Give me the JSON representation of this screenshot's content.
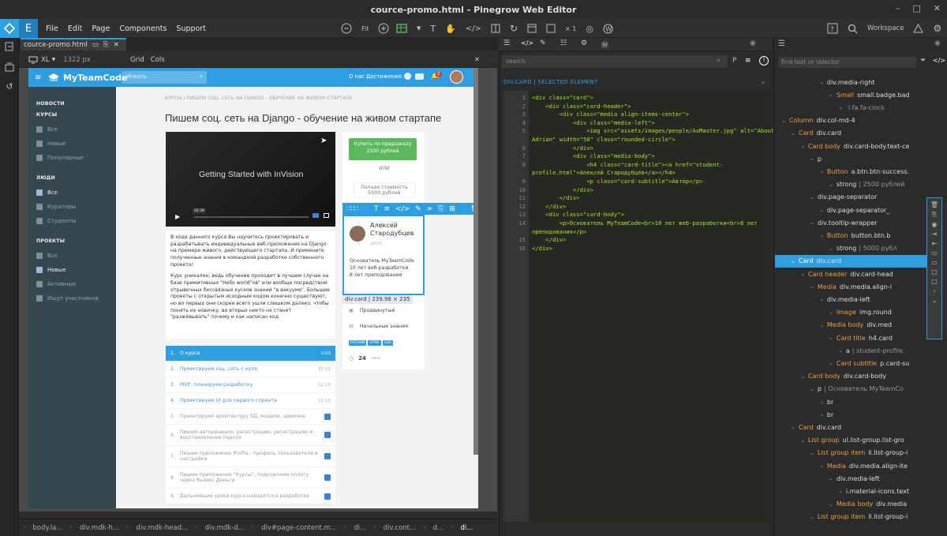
{
  "app": {
    "title": "cource-promo.html - Pinegrow Web Editor"
  },
  "menu": [
    "File",
    "Edit",
    "Page",
    "Components",
    "Support"
  ],
  "toolbar": {
    "fit_label": "Fit",
    "multiplier": "× 1",
    "workspace": "Workspace"
  },
  "tab": {
    "label": "cource-promo.html"
  },
  "device": {
    "size": "XL",
    "width": "1322 px",
    "grid": "Grid",
    "cols": "Cols"
  },
  "site": {
    "brand": "MyTeamCode",
    "search_placeholder": "Искать",
    "nav_links": "О нас  Достижения",
    "notif_count": "2",
    "sidebar": [
      {
        "type": "heading",
        "label": "НОВОСТИ"
      },
      {
        "type": "heading",
        "label": "КУРСЫ"
      },
      {
        "type": "item",
        "label": "Все"
      },
      {
        "type": "item",
        "label": "Новые"
      },
      {
        "type": "item",
        "label": "Популярные"
      },
      {
        "type": "heading",
        "label": "ЛЮДИ"
      },
      {
        "type": "item",
        "label": "Все",
        "active": true
      },
      {
        "type": "item",
        "label": "Кураторы"
      },
      {
        "type": "item",
        "label": "Студенты"
      },
      {
        "type": "heading",
        "label": "ПРОЕКТЫ"
      },
      {
        "type": "item",
        "label": "Все"
      },
      {
        "type": "item",
        "label": "Новые",
        "active": true
      },
      {
        "type": "item",
        "label": "Активные"
      },
      {
        "type": "item",
        "label": "Ищут участников"
      }
    ],
    "breadcrumb": "КУРСЫ  /  ПИШЕМ СОЦ. СЕТЬ НА DJANGO - ОБУЧЕНИЕ НА ЖИВОМ СТАРТАПЕ",
    "heading": "Пишем соц. сеть на Django - обучение на живом стартапе",
    "video": {
      "title": "Getting Started with InVision",
      "time": "02:36"
    },
    "description_p1": "В ходе данного курса Вы научитесь проектировать и разрабатывать индивидуальные веб-приложения на Django на примере живого, действующего стартапа. И примените полученные знания в командной разработке собственного проекта!",
    "description_p2": "Курс уникален, ведь обучение проходит в лучшем случае на базе примитивных \"Hello world\"ов\" или вообще посредством отрывочных бессвязных кусков знаний \"в вакууме\". Большие проекты с открытым исходным кодом конечно существуют, но во первых они скорее всего ушли слишком далеко, чтобы понять их новичку, во вторых никто не станет \"разжёвывать\" почему и как написан код",
    "lessons": [
      {
        "n": "1.",
        "title": "О курсе",
        "time": "2:03",
        "state": "active"
      },
      {
        "n": "2.",
        "title": "Проектируем соц. сеть с нуля",
        "time": "25:01",
        "state": "open"
      },
      {
        "n": "3.",
        "title": "MVP, планируем разработку",
        "time": "12:10",
        "state": "open"
      },
      {
        "n": "4.",
        "title": "Проектируем UI для первого спринта",
        "time": "12:10",
        "state": "open"
      },
      {
        "n": "5.",
        "title": "Проектируем архитектуру БД, модели, админка",
        "time": "",
        "state": "locked"
      },
      {
        "n": "6.",
        "title": "Пишем авторизацию, регистрацию, регистрацию и восстановление пароля",
        "time": "",
        "state": "locked"
      },
      {
        "n": "7.",
        "title": "Пишем приложение Profile - профиль пользователя и настройки",
        "time": "",
        "state": "locked"
      },
      {
        "n": "8.",
        "title": "Пишем приложение \"Курсы\", подключаем оплату через Яндекс Деньги",
        "time": "",
        "state": "locked"
      },
      {
        "n": "9.",
        "title": "Дальнейшие уроки курса находятся в разработке",
        "time": "",
        "state": "locked"
      }
    ],
    "buy_button": "Купить по предзаказу 2500 рублей",
    "or": "ИЛИ",
    "full_price_label": "Полная стоимость",
    "full_price": "5000 рублей",
    "author_name": "Алексей Стародубцев",
    "author_role": "Автор",
    "card_body": [
      "Основатель MyTeamCode",
      "10 лет веб-разработки",
      "8 лет преподования"
    ],
    "level1": "Продвинутый",
    "level2": "Начальные знания",
    "tags": [
      "PYTHON",
      "HTML",
      "CSS"
    ],
    "hours": "24",
    "hours_unit": "часа"
  },
  "selection_label": "div.card | 239.98 × 235",
  "code": {
    "search_placeholder": "search",
    "selected_title": "DIV.CARD | SELECTED ELEMENT",
    "lines": [
      "<div class=\"card\">",
      "    <div class=\"card-header\">",
      "        <div class=\"media align-items-center\">",
      "            <div class=\"media-left\">",
      "                <img src=\"assets/images/people/AsMaster.jpg\" alt=\"About",
      "Adrian\" width=\"50\" class=\"rounded-circle\">",
      "            </div>",
      "            <div class=\"media-body\">",
      "                <h4 class=\"card-title\"><a href=\"student-",
      "profile.html\">Алексей Стародубцев</a></h4>",
      "                <p class=\"card-subtitle\">Автор</p>",
      "            </div>",
      "        </div>",
      "    </div>",
      "    <div class=\"card-body\">",
      "        <p>Основатель MyTeamCode<br>10 лет веб-разработки<br>8 лет",
      "преподования</p>",
      "    </div>",
      "</div>"
    ],
    "gutter": [
      "1",
      "2",
      "3",
      "4",
      "5",
      "",
      "6",
      "7",
      "8",
      "",
      "9",
      "10",
      "11",
      "12",
      "13",
      "14",
      "",
      "15",
      "16"
    ]
  },
  "tree": {
    "search_placeholder": "find text or selector",
    "rows": [
      {
        "d": 8,
        "tg": "div.media-right"
      },
      {
        "d": 9,
        "k": "Small",
        "tg": "small.badge.bad"
      },
      {
        "d": 10,
        "n": "i.fa.fa-clock"
      },
      {
        "d": 4,
        "k": "Column",
        "tg": "div.col-md-4"
      },
      {
        "d": 5,
        "k": "Card",
        "tg": "div.card"
      },
      {
        "d": 6,
        "k": "Card body",
        "tg": "div.card-body.text-ce"
      },
      {
        "d": 7,
        "tg": "p"
      },
      {
        "d": 8,
        "k": "Button",
        "tg": "a.btn.btn-success."
      },
      {
        "d": 9,
        "tg": "strong",
        "n": "| 2500 рублей"
      },
      {
        "d": 7,
        "tg": "div.page-separator"
      },
      {
        "d": 8,
        "tg": "div.page-separator_"
      },
      {
        "d": 7,
        "tg": "div.tooltip-wrapper"
      },
      {
        "d": 8,
        "k": "Button",
        "tg": "button.btn.b"
      },
      {
        "d": 9,
        "tg": "strong",
        "n": "| 5000 рубл"
      },
      {
        "d": 5,
        "k": "Card",
        "tg": "div.card",
        "sel": true
      },
      {
        "d": 6,
        "k": "Card header",
        "tg": "div.card-head"
      },
      {
        "d": 7,
        "k": "Media",
        "tg": "div.media.align-i"
      },
      {
        "d": 8,
        "tg": "div.media-left"
      },
      {
        "d": 9,
        "k": "Image",
        "tg": "img.round"
      },
      {
        "d": 8,
        "k": "Media body",
        "tg": "div.med"
      },
      {
        "d": 9,
        "k": "Card title",
        "tg": "h4.card"
      },
      {
        "d": 10,
        "tg": "a",
        "n": "| student-profile."
      },
      {
        "d": 9,
        "k": "Card subtitle",
        "tg": "p.card-su"
      },
      {
        "d": 6,
        "k": "Card body",
        "tg": "div.card-body"
      },
      {
        "d": 7,
        "tg": "p",
        "n": "| Основатель MyTeamCo"
      },
      {
        "d": 8,
        "tg": "br"
      },
      {
        "d": 8,
        "tg": "br"
      },
      {
        "d": 5,
        "k": "Card",
        "tg": "div.card"
      },
      {
        "d": 6,
        "k": "List group",
        "tg": "ul.list-group.list-gro"
      },
      {
        "d": 7,
        "k": "List group item",
        "tg": "li.list-group-i"
      },
      {
        "d": 8,
        "k": "Media",
        "tg": "div.media.align-ite"
      },
      {
        "d": 9,
        "tg": "div.media-left"
      },
      {
        "d": 10,
        "tg": "i.material-icons.text"
      },
      {
        "d": 9,
        "k": "Media body",
        "tg": "div.media"
      },
      {
        "d": 7,
        "k": "List group item",
        "tg": "li.list-group-i"
      }
    ]
  },
  "breadcrumbs_bottom": [
    "body.la...",
    "div.mdk-h...",
    "div.mdk-head...",
    "div.mdk-d...",
    "div#page-content.m...",
    "di...",
    "div.cont...",
    "d...",
    "di..."
  ],
  "colors": {
    "accent": "#2f9ee0",
    "success": "#5cb85c",
    "code_tag": "#a6e22e",
    "tree_key": "#e8a04a"
  }
}
